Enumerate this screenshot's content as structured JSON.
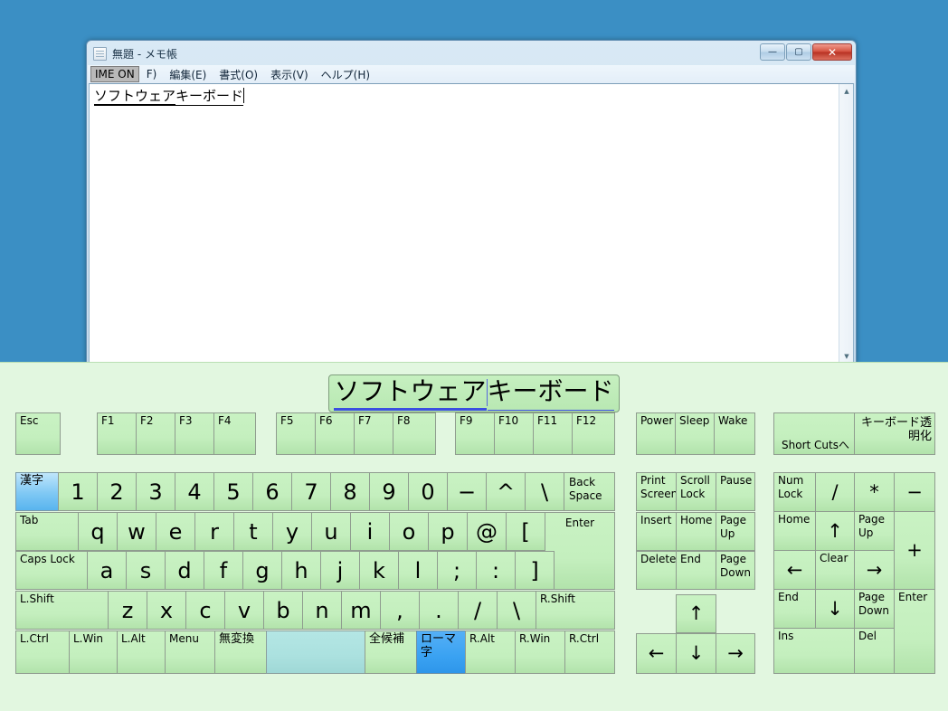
{
  "desktop": {
    "background_color": "#3b8fc4"
  },
  "notepad": {
    "title": "無題 - メモ帳",
    "icon": "notepad-icon",
    "window_buttons": {
      "minimize": "—",
      "maximize": "▢",
      "close": "✕"
    },
    "ime_indicator": "IME ON",
    "menus": [
      "F)",
      "編集(E)",
      "書式(O)",
      "表示(V)",
      "ヘルプ(H)"
    ],
    "document_text": {
      "segment_committed": "ソフトウェア",
      "segment_pending": "キーボード"
    },
    "scrollbar": {
      "up": "▲",
      "down": "▼"
    }
  },
  "keyboard": {
    "title": {
      "part1": "ソフトウェア",
      "part2": "キーボード"
    },
    "accent_selected": "#3aa2f2",
    "accent_key": "#7fc8f4",
    "key_face": "#c4efbe",
    "panel_background": "#e2f7e0",
    "rows": {
      "function_row": {
        "esc": "Esc",
        "f_group1": [
          "F1",
          "F2",
          "F3",
          "F4"
        ],
        "f_group2": [
          "F5",
          "F6",
          "F7",
          "F8"
        ],
        "f_group3": [
          "F9",
          "F10",
          "F11",
          "F12"
        ],
        "power_group": [
          "Power",
          "Sleep",
          "Wake"
        ],
        "shortcuts": "Short Cutsへ",
        "transparency": "キーボード透明化"
      },
      "number_row": [
        "漢字",
        "1",
        "2",
        "3",
        "4",
        "5",
        "6",
        "7",
        "8",
        "9",
        "0",
        "−",
        "^",
        "\\",
        "Back Space"
      ],
      "qwerty_row": [
        "Tab",
        "q",
        "w",
        "e",
        "r",
        "t",
        "y",
        "u",
        "i",
        "o",
        "p",
        "@",
        "["
      ],
      "enter_key": "Enter",
      "asdf_row": [
        "Caps Lock",
        "a",
        "s",
        "d",
        "f",
        "g",
        "h",
        "j",
        "k",
        "l",
        ";",
        ":",
        "]"
      ],
      "zxcv_row": [
        "L.Shift",
        "z",
        "x",
        "c",
        "v",
        "b",
        "n",
        "m",
        ",",
        ".",
        "/",
        "\\",
        "R.Shift"
      ],
      "bottom_row": [
        "L.Ctrl",
        "L.Win",
        "L.Alt",
        "Menu",
        "無変換",
        "",
        "全候補",
        "ローマ字",
        "R.Alt",
        "R.Win",
        "R.Ctrl"
      ]
    },
    "nav_cluster": {
      "row1": [
        "Print Screen",
        "Scroll Lock",
        "Pause"
      ],
      "row2": [
        "Insert",
        "Home",
        "Page Up"
      ],
      "row3": [
        "Delete",
        "End",
        "Page Down"
      ],
      "arrow_up": "↑",
      "arrow_left": "←",
      "arrow_down": "↓",
      "arrow_right": "→"
    },
    "numpad": {
      "row1": [
        "Num Lock",
        "/",
        "*",
        "−"
      ],
      "row2": [
        "Home",
        "↑",
        "Page Up"
      ],
      "plus": "+",
      "row3": [
        "←",
        "Clear",
        "→"
      ],
      "row4": [
        "End",
        "↓",
        "Page Down"
      ],
      "enter": "Enter",
      "row5": [
        "Ins",
        "Del"
      ]
    },
    "selected_keys": [
      "漢字",
      "ローマ字"
    ]
  }
}
